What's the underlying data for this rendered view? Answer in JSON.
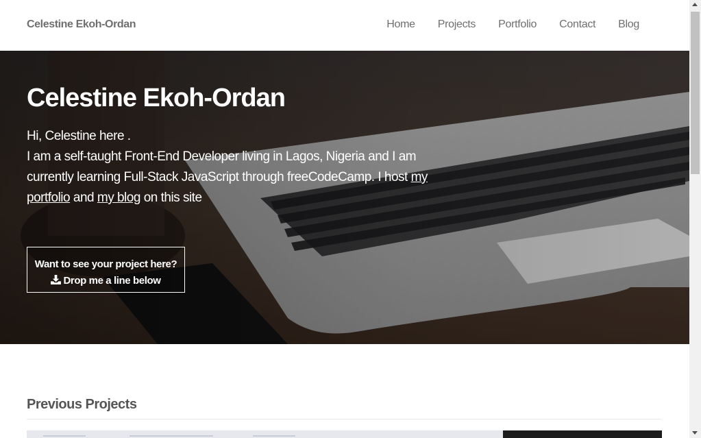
{
  "navbar": {
    "brand": "Celestine Ekoh-Ordan",
    "links": [
      {
        "label": "Home"
      },
      {
        "label": "Projects"
      },
      {
        "label": "Portfolio"
      },
      {
        "label": "Contact"
      },
      {
        "label": "Blog"
      }
    ]
  },
  "hero": {
    "title": "Celestine Ekoh-Ordan",
    "greeting": "Hi, Celestine here .",
    "bio_text": "I am a self-taught Front-End Developer living in Lagos, Nigeria and I am currently learning Full-Stack JavaScript through freeCodeCamp. I host",
    "portfolio_link": "my portfolio",
    "and_text": "and",
    "blog_link": "my blog",
    "suffix_text": "on this site",
    "cta": {
      "line1": "Want to see your project here?",
      "line2": "Drop me a line below",
      "icon": "download-icon"
    }
  },
  "projects": {
    "heading": "Previous Projects"
  },
  "colors": {
    "nav_text": "#6f6f6f",
    "hero_text": "#ffffff",
    "section_heading": "#555555"
  }
}
